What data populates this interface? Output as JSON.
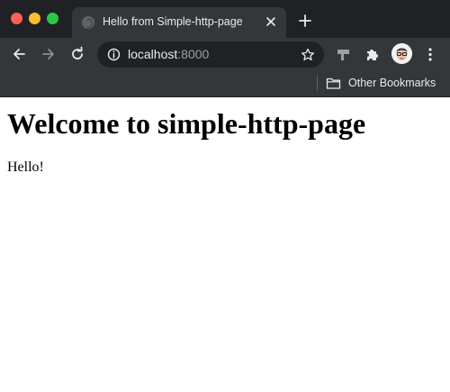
{
  "tab": {
    "title": "Hello from Simple-http-page"
  },
  "omnibox": {
    "host": "localhost",
    "port": ":8000"
  },
  "bookmarks_bar": {
    "other_bookmarks": "Other Bookmarks"
  },
  "page": {
    "heading": "Welcome to simple-http-page",
    "paragraph": "Hello!"
  },
  "colors": {
    "titlebar": "#202124",
    "toolbar": "#35363a",
    "close_red": "#ff5f57",
    "minimize_yellow": "#febc2e",
    "zoom_green": "#28c840"
  },
  "icons": {
    "window_controls": [
      "close-window-icon",
      "minimize-window-icon",
      "zoom-window-icon"
    ],
    "tab": [
      "globe-favicon-icon",
      "close-tab-icon"
    ],
    "toolbar": [
      "back-arrow-icon",
      "forward-arrow-icon",
      "reload-icon",
      "site-info-icon",
      "bookmark-star-icon",
      "extension-icon",
      "puzzle-icon",
      "profile-avatar",
      "kebab-menu-icon"
    ],
    "bookmarks": [
      "folder-icon"
    ]
  }
}
